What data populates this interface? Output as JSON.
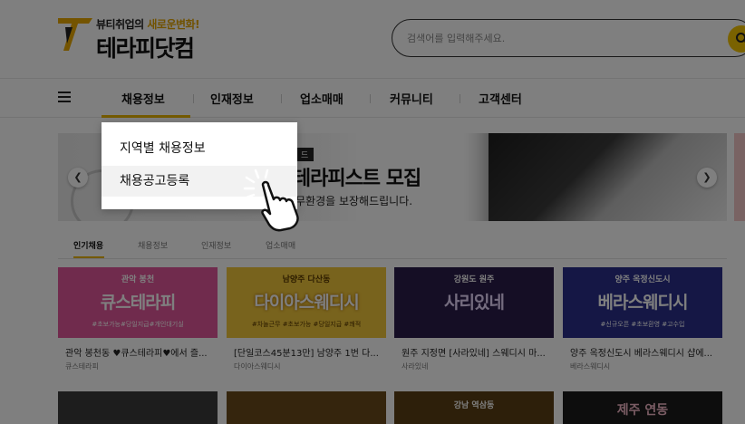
{
  "header": {
    "logo_tagline_pre": "뷰티취업의 ",
    "logo_tagline_hl": "새로운변화!",
    "logo_name": "테라피닷컴",
    "search_placeholder": "검색어를 입력해주세요."
  },
  "nav": {
    "items": [
      "채용정보",
      "인재정보",
      "업소매매",
      "커뮤니티",
      "고객센터"
    ],
    "active_index": 0
  },
  "dropdown": {
    "items": [
      "지역별 채용정보",
      "채용공고등록"
    ],
    "hovered_index": 1
  },
  "banner": {
    "tag": "드",
    "title": "I 테라피스트 모집",
    "subtitle": "무환경을 보장해드립니다."
  },
  "tabs": {
    "items": [
      "인기채용",
      "채용정보",
      "인재정보",
      "업소매매"
    ],
    "active_index": 0
  },
  "cards": [
    {
      "thumb_small": "관악 봉천",
      "thumb_main": "큐스테라피",
      "thumb_foot": "#초보가능#당일지급#개인대기실",
      "title": "관악 봉천동 ♥큐스테라피♥에서 즐...",
      "shop": "큐스테라피",
      "bg": "#e0569a"
    },
    {
      "thumb_small": "남양주 다산동",
      "thumb_main": "다이아스웨디시",
      "thumb_foot": "#차놀근무 #초보가능 #당일지급 #쾌적",
      "title": "[단일코스45분13만] 남양주 1번 다...",
      "shop": "다이아스웨디시",
      "bg": "#f0c63a"
    },
    {
      "thumb_small": "강원도 원주",
      "thumb_main": "사리있네",
      "thumb_foot": "",
      "title": "원주 지정면 [사라있네] 스웨디시 마...",
      "shop": "사라있네",
      "bg": "#2b1d4a"
    },
    {
      "thumb_small": "양주 옥정신도시",
      "thumb_main": "베라스웨디시",
      "thumb_foot": "#신규오픈 #초보환영 #고수입",
      "title": "양주 옥정신도시 베라스웨디시 샵에...",
      "shop": "베라스웨디시",
      "bg": "#2a2f8a"
    }
  ],
  "row2": [
    {
      "text": "",
      "bg": "#3a3a3a"
    },
    {
      "text": "",
      "bg": "#6a4a1a"
    },
    {
      "text": "강남 역삼동",
      "bg": "#5a3e14"
    },
    {
      "text": "제주 연동",
      "bg": "#1a1a1a"
    }
  ]
}
